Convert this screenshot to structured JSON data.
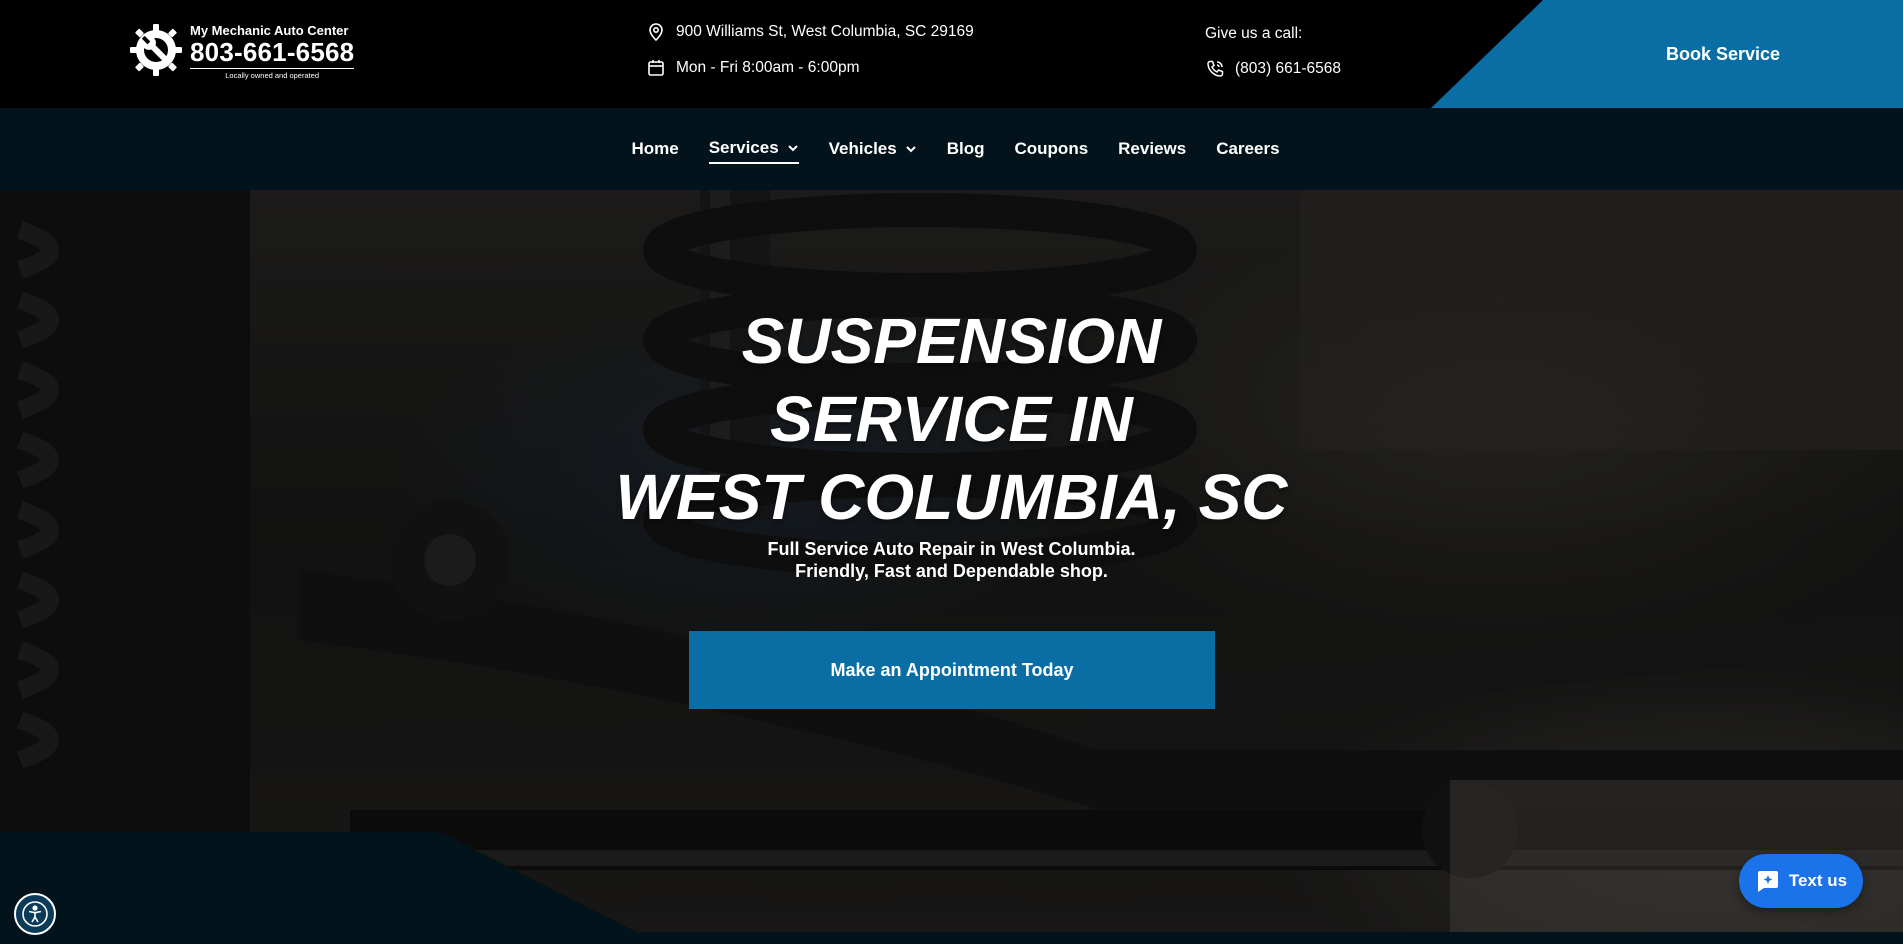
{
  "header": {
    "logo": {
      "name": "My Mechanic Auto Center",
      "phone": "803-661-6568",
      "tagline": "Locally owned and operated"
    },
    "address": "900 Williams St, West Columbia, SC 29169",
    "hours": "Mon - Fri 8:00am - 6:00pm",
    "call_label": "Give us a call:",
    "call_phone": "(803) 661-6568",
    "book_label": "Book Service"
  },
  "nav": {
    "items": [
      {
        "label": "Home"
      },
      {
        "label": "Services"
      },
      {
        "label": "Vehicles"
      },
      {
        "label": "Blog"
      },
      {
        "label": "Coupons"
      },
      {
        "label": "Reviews"
      },
      {
        "label": "Careers"
      }
    ]
  },
  "hero": {
    "title_lines": [
      "SUSPENSION",
      "SERVICE IN",
      "WEST COLUMBIA, SC"
    ],
    "subtitle_lines": [
      "Full Service Auto Repair in West Columbia.",
      "Friendly, Fast and Dependable shop."
    ],
    "cta_label": "Make an Appointment Today"
  },
  "widgets": {
    "text_us_label": "Text us"
  },
  "colors": {
    "brand_blue": "#0a6ea4",
    "nav_bg": "#03131b",
    "chat_blue": "#1a73e8"
  },
  "icons": {
    "logo": "gear-wrench-icon",
    "address": "map-pin-icon",
    "hours": "calendar-icon",
    "phone": "phone-icon",
    "accessibility": "accessibility-icon",
    "chat": "chat-bubble-icon"
  }
}
